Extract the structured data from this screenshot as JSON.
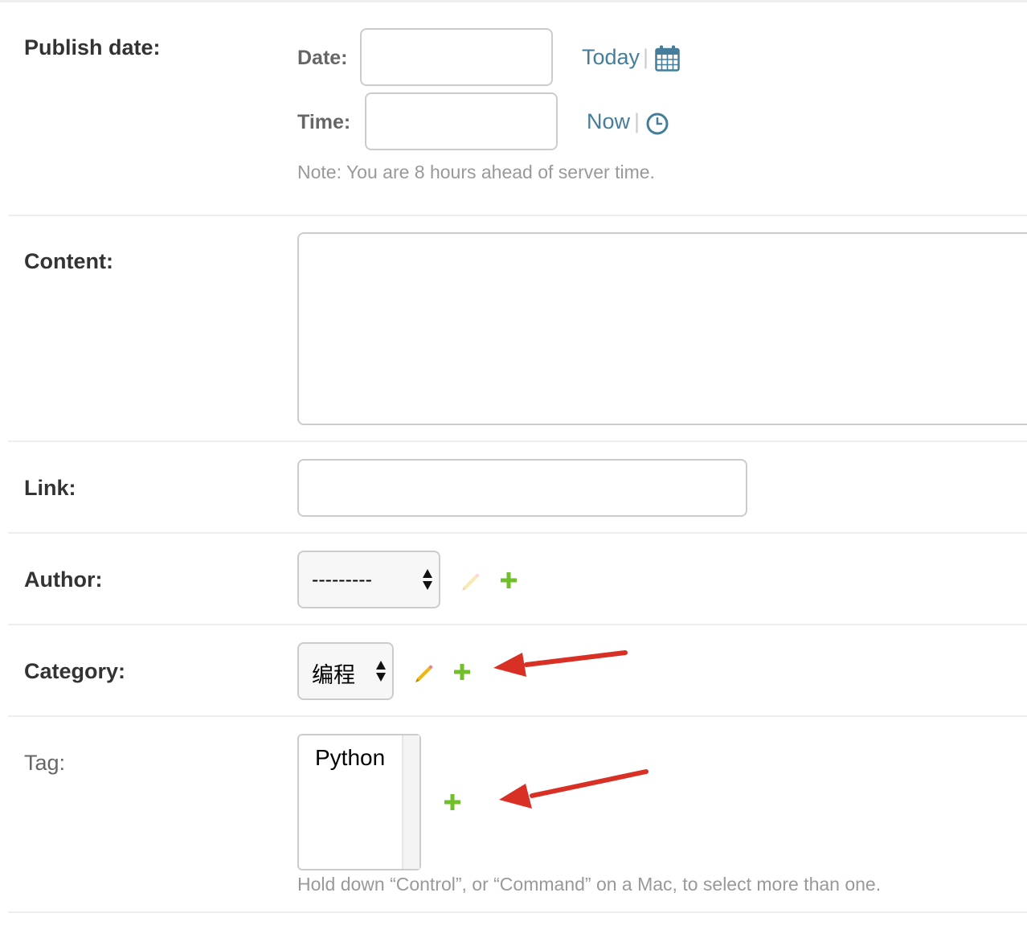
{
  "publish_date": {
    "label": "Publish date:",
    "date_label": "Date:",
    "date_value": "",
    "today_link": "Today",
    "separator": "|",
    "calendar_icon": "calendar-icon",
    "time_label": "Time:",
    "time_value": "",
    "now_link": "Now",
    "clock_icon": "clock-icon",
    "note": "Note: You are 8 hours ahead of server time."
  },
  "content": {
    "label": "Content:",
    "value": ""
  },
  "link": {
    "label": "Link:",
    "value": ""
  },
  "author": {
    "label": "Author:",
    "selected": "---------",
    "edit_icon": "pencil-icon",
    "add_icon": "plus-icon"
  },
  "category": {
    "label": "Category:",
    "selected": "编程",
    "edit_icon": "pencil-icon",
    "add_icon": "plus-icon"
  },
  "tag": {
    "label": "Tag:",
    "options": [
      "Python"
    ],
    "add_icon": "plus-icon",
    "help": "Hold down “Control”, or “Command” on a Mac, to select more than one."
  },
  "colors": {
    "link": "#447e9b",
    "add_green": "#70bf2b",
    "edit_yellow": "#efb80b",
    "annotation_arrow": "#d93025",
    "border": "#cccccc",
    "help_text": "#999999"
  }
}
